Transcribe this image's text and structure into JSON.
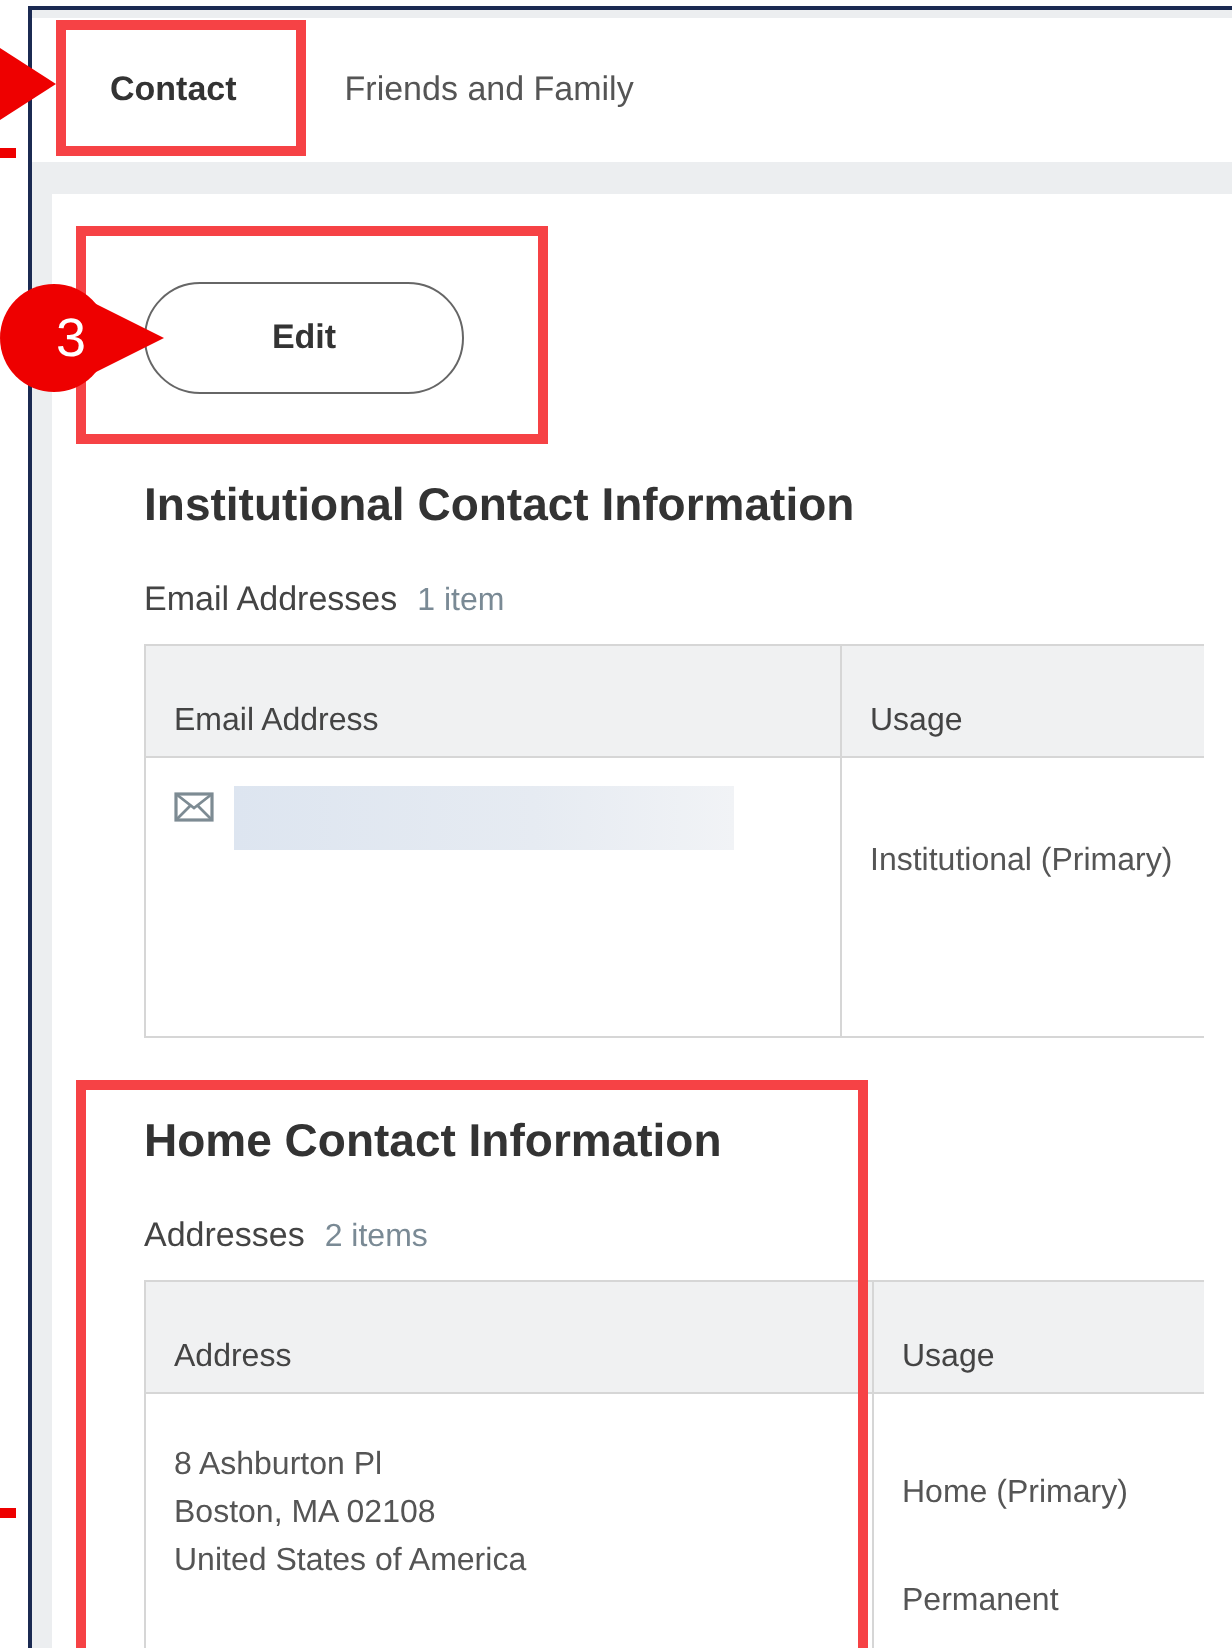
{
  "tabs": [
    {
      "label": "Contact",
      "selected": true
    },
    {
      "label": "Friends and Family",
      "selected": false
    }
  ],
  "edit_button": {
    "label": "Edit"
  },
  "sections": [
    {
      "title": "Institutional Contact Information",
      "group": {
        "title": "Email Addresses",
        "count": "1 item",
        "columns": [
          "Email Address",
          "Usage"
        ],
        "rows": [
          {
            "kind": "email",
            "usages": [
              "Institutional (Primary)"
            ]
          }
        ]
      }
    },
    {
      "title": "Home Contact Information",
      "group": {
        "title": "Addresses",
        "count": "2 items",
        "columns": [
          "Address",
          "Usage"
        ],
        "rows": [
          {
            "kind": "address",
            "lines": [
              "8 Ashburton Pl",
              "Boston, MA 02108",
              "United States of America"
            ],
            "usages": [
              "Home (Primary)",
              "Permanent"
            ]
          }
        ]
      }
    }
  ],
  "annotations": {
    "callouts": [
      {
        "label": "3"
      }
    ]
  }
}
